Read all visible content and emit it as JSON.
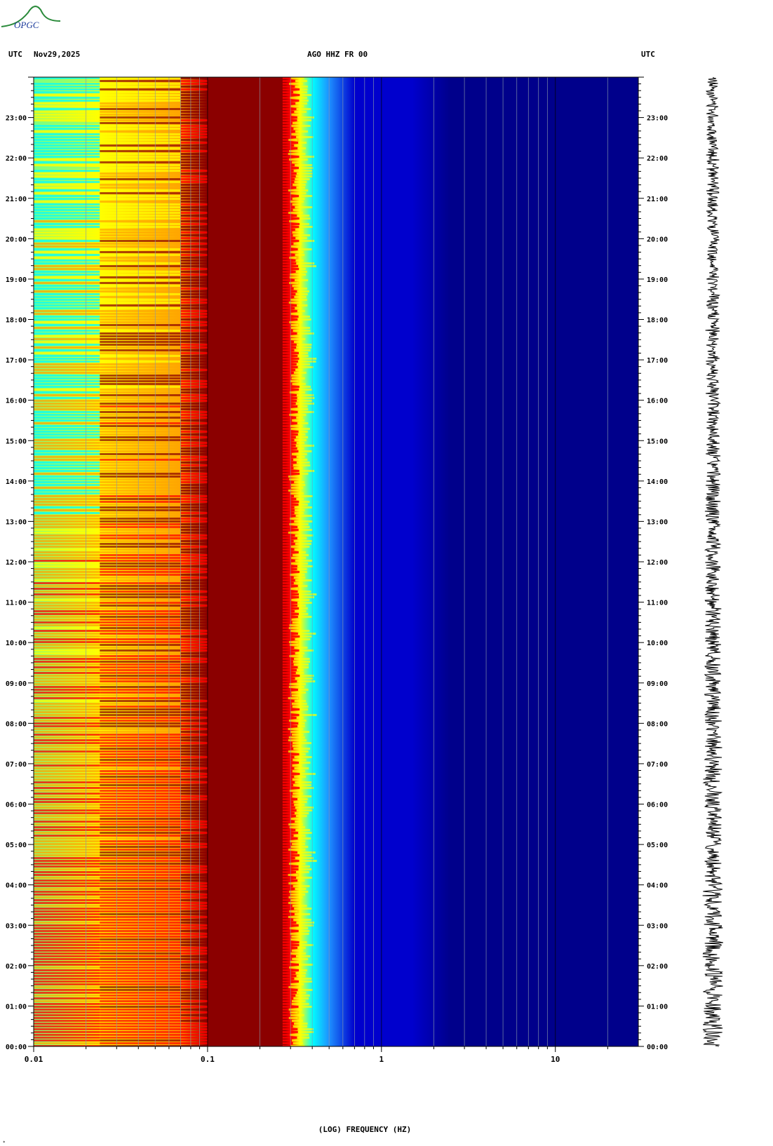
{
  "logo": {
    "text": "OPGC",
    "color": "#2a8a3a"
  },
  "header": {
    "left_tz": "UTC",
    "date": "Nov29,2025",
    "station": "AGO HHZ FR 00",
    "right_tz": "UTC"
  },
  "chart_data": {
    "type": "heatmap",
    "title": "AGO HHZ FR 00",
    "xlabel": "(LOG) FREQUENCY (HZ)",
    "ylabel": "",
    "x_scale": "log",
    "xlim": [
      0.01,
      30
    ],
    "x_ticks": [
      "0.01",
      "0.1",
      "1",
      "10"
    ],
    "ylim_hours": [
      0,
      24
    ],
    "y_ticks": [
      "00:00",
      "01:00",
      "02:00",
      "03:00",
      "04:00",
      "05:00",
      "06:00",
      "07:00",
      "08:00",
      "09:00",
      "10:00",
      "11:00",
      "12:00",
      "13:00",
      "14:00",
      "15:00",
      "16:00",
      "17:00",
      "18:00",
      "19:00",
      "20:00",
      "21:00",
      "22:00",
      "23:00"
    ],
    "colormap": [
      "#00008b",
      "#0000cd",
      "#1e90ff",
      "#00ffff",
      "#7fff7f",
      "#ffff00",
      "#ffa500",
      "#ff0000",
      "#8b0000"
    ],
    "dominant_band_hz": [
      0.1,
      0.3
    ],
    "grid": true,
    "seismogram_trace": true
  },
  "footer": {
    "corner_mark": "*"
  }
}
